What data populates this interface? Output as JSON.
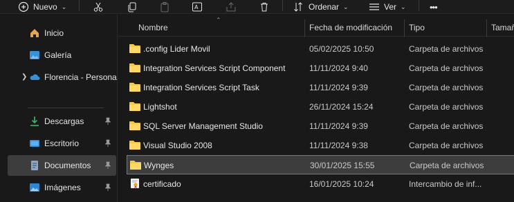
{
  "toolbar": {
    "new_label": "Nuevo",
    "sort_label": "Ordenar",
    "view_label": "Ver",
    "more_label": "•••",
    "icons": [
      "plus-circle-icon",
      "cut-icon",
      "copy-icon",
      "paste-icon",
      "rename-icon",
      "share-icon",
      "delete-icon",
      "sort-icon",
      "view-icon",
      "more-icon"
    ]
  },
  "sidebar": {
    "items": [
      {
        "label": "Inicio",
        "icon": "home-icon",
        "pinned": false
      },
      {
        "label": "Galería",
        "icon": "gallery-icon",
        "pinned": false
      },
      {
        "label": "Florencia - Persona",
        "icon": "onedrive-icon",
        "pinned": false,
        "expandable": true
      },
      {
        "label": "Descargas",
        "icon": "download-icon",
        "pinned": true
      },
      {
        "label": "Escritorio",
        "icon": "desktop-icon",
        "pinned": true
      },
      {
        "label": "Documentos",
        "icon": "documents-icon",
        "pinned": true,
        "selected": true
      },
      {
        "label": "Imágenes",
        "icon": "pictures-icon",
        "pinned": true
      }
    ]
  },
  "table": {
    "columns": [
      "Nombre",
      "Fecha de modificación",
      "Tipo",
      "Tamaño"
    ],
    "rows": [
      {
        "name": ".config Lider Movil",
        "date": "05/02/2025 10:50",
        "type": "Carpeta de archivos",
        "kind": "folder"
      },
      {
        "name": "Integration Services Script Component",
        "date": "11/11/2024 9:40",
        "type": "Carpeta de archivos",
        "kind": "folder"
      },
      {
        "name": "Integration Services Script Task",
        "date": "11/11/2024 9:39",
        "type": "Carpeta de archivos",
        "kind": "folder"
      },
      {
        "name": "Lightshot",
        "date": "26/11/2024 15:24",
        "type": "Carpeta de archivos",
        "kind": "folder"
      },
      {
        "name": "SQL Server Management Studio",
        "date": "11/11/2024 9:39",
        "type": "Carpeta de archivos",
        "kind": "folder"
      },
      {
        "name": "Visual Studio 2008",
        "date": "11/11/2024 9:38",
        "type": "Carpeta de archivos",
        "kind": "folder"
      },
      {
        "name": "Wynges",
        "date": "30/01/2025 15:55",
        "type": "Carpeta de archivos",
        "kind": "folder",
        "selected": true
      },
      {
        "name": "certificado",
        "date": "16/01/2025 10:24",
        "type": "Intercambio de inf...",
        "kind": "certificate"
      }
    ]
  },
  "colors": {
    "background": "#191919",
    "selection": "#3d3d3d",
    "folder": "#f5c84a",
    "accent": "#4aa3e8"
  }
}
